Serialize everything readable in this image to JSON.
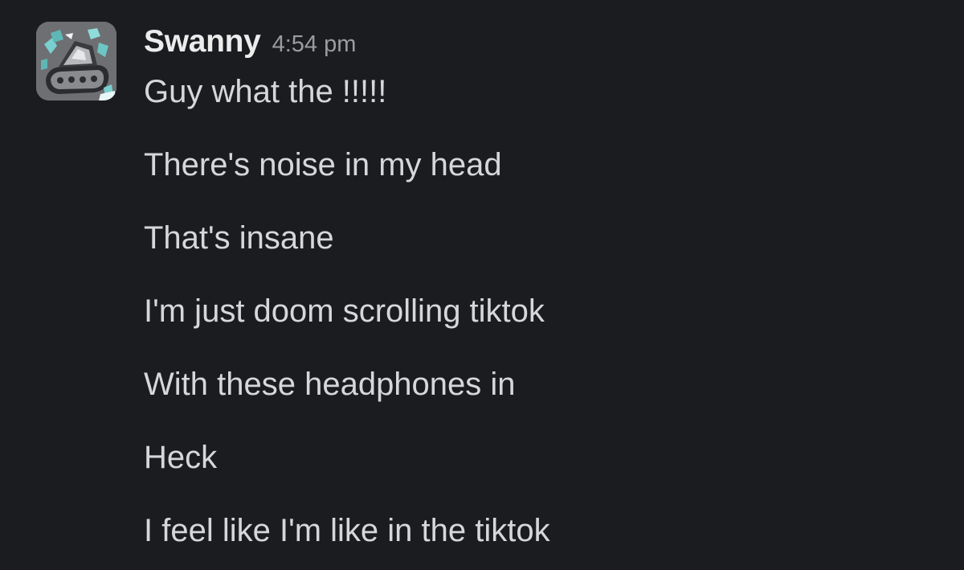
{
  "message": {
    "sender": "Swanny",
    "time": "4:54 pm",
    "avatar_icon": "mech-robot-avatar",
    "lines": [
      "Guy what the !!!!!",
      "There's noise in my head",
      "That's insane",
      "I'm just doom scrolling tiktok",
      "With these headphones in",
      "Heck",
      "I feel like I'm like in the tiktok"
    ]
  },
  "colors": {
    "background": "#1b1c20",
    "sender": "#ececed",
    "timestamp": "#9b9c9f",
    "text": "#d6d7d8"
  }
}
